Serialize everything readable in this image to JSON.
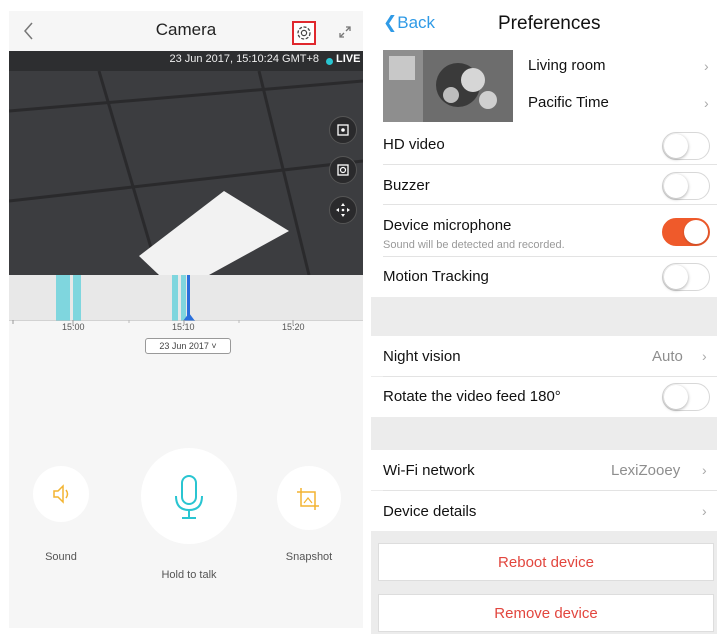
{
  "left": {
    "title": "Camera",
    "timestamp": "23 Jun 2017, 15:10:24 GMT+8",
    "live_label": "LIVE",
    "timeline": {
      "ticks": [
        "15:00",
        "15:10",
        "15:20"
      ],
      "date_selector": "23 Jun 2017 ˅"
    },
    "controls": {
      "sound_label": "Sound",
      "talk_label": "Hold to talk",
      "snapshot_label": "Snapshot"
    },
    "colors": {
      "accent": "#29c5d1",
      "highlight": "#e0282e",
      "control_icon": "#f3b431"
    }
  },
  "right": {
    "back_label": "❮CBack",
    "title": "Preferences",
    "device_name": "Living room",
    "time_zone": "Pacific Time",
    "rows": {
      "hd_video": {
        "label": "HD video",
        "on": false
      },
      "buzzer": {
        "label": "Buzzer",
        "on": false
      },
      "microphone": {
        "label": "Device microphone",
        "sub": "Sound will be detected and recorded.",
        "on": true
      },
      "motion": {
        "label": "Motion Tracking",
        "on": false
      },
      "night_vision": {
        "label": "Night vision",
        "value": "Auto"
      },
      "rotate": {
        "label": "Rotate the video feed 180°",
        "on": false
      },
      "wifi": {
        "label": "Wi-Fi network",
        "value": "LexiZooey"
      },
      "details": {
        "label": "Device details"
      }
    },
    "reboot_label": "Reboot device",
    "remove_label": "Remove device",
    "colors": {
      "link": "#2f9ae6",
      "toggle_on": "#ef5a2b",
      "danger": "#e2463e"
    }
  }
}
